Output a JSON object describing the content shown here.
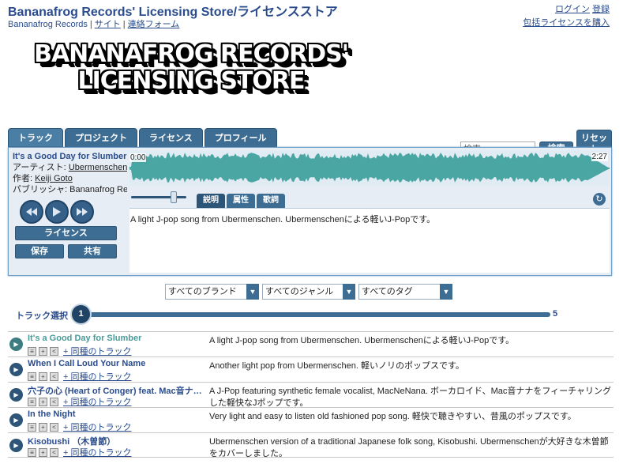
{
  "header": {
    "title": "Bananafrog Records' Licensing Store/ライセンスストア",
    "nav": {
      "brand": "Bananafrog Records",
      "site": "サイト",
      "contact": "連絡フォーム"
    },
    "login": "ログイン",
    "register": "登録",
    "bulk_license": "包括ライセンスを購入"
  },
  "logo": {
    "line1": "BANANAFROG RECORDS'",
    "line2": "LICENSING STORE"
  },
  "tabs": [
    "トラック",
    "プロジェクト",
    "ライセンス",
    "プロフィール"
  ],
  "search": {
    "placeholder": "検索...",
    "button": "検索",
    "reset": "リセット"
  },
  "player": {
    "title": "It's a Good Day for Slumber",
    "artist_label": "アーティスト:",
    "artist": "Ubermenschen",
    "composer_label": "作者:",
    "composer": "Keiji Goto",
    "publisher_label": "パブリッシャ:",
    "publisher": "Bananafrog Rec...",
    "license_button": "ライセンス",
    "save_button": "保存",
    "share_button": "共有",
    "time_start": "0:00",
    "time_end": "2:27",
    "subtabs": [
      "説明",
      "属性",
      "歌詞"
    ],
    "description": "A light J-pop song from Ubermenschen. Ubermenschenによる軽いJ-Popです。",
    "progress": 0,
    "volume": 0.75
  },
  "filters": {
    "brand": "すべてのブランド",
    "genre": "すべてのジャンル",
    "tag": "すべてのタグ"
  },
  "track_slider": {
    "label": "トラック選択",
    "current": "1",
    "max": "5"
  },
  "similar_label": "+ 同種のトラック",
  "tracks": [
    {
      "title": "It's a Good Day for Slumber",
      "desc": "A light J-pop song from Ubermenschen. Ubermenschenによる軽いJ-Popです。"
    },
    {
      "title": "When I Call Loud Your Name",
      "desc": "Another light pop from Ubermenschen. 軽いノリのポップスです。"
    },
    {
      "title": "穴子の心 (Heart of Conger) feat. Mac音ナナ (...",
      "desc": "A J-Pop featuring synthetic female vocalist, MacNeNana. ボーカロイド、Mac音ナナをフィーチャリングした軽快なJポップです。"
    },
    {
      "title": "In the Night",
      "desc": "Very light and easy to listen old fashioned pop song. 軽快で聴きやすい、昔風のポップスです。"
    },
    {
      "title": "Kisobushi （木曽節）",
      "desc": "Ubermenschen version of a traditional Japanese folk song, Kisobushi. Ubermenschenが大好きな木曽節をカバーしました。"
    }
  ]
}
